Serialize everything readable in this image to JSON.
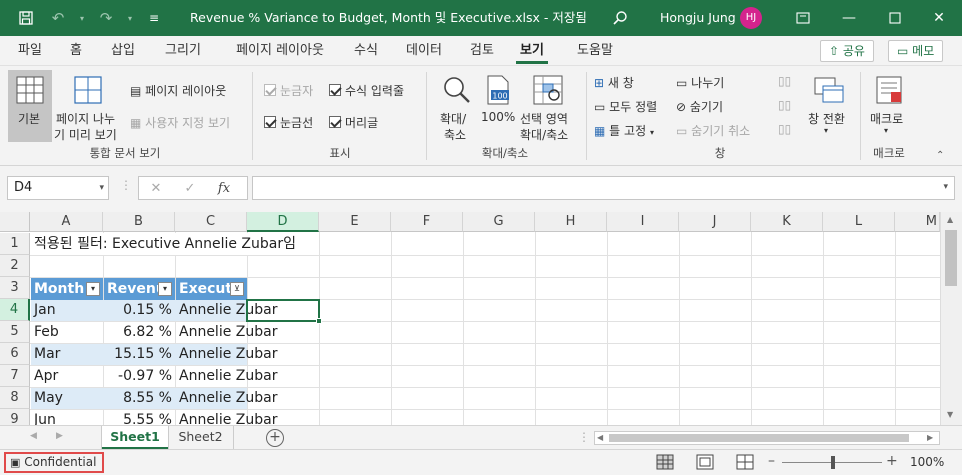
{
  "titlebar": {
    "title": "Revenue % Variance to Budget, Month 및 Executive.xlsx  -  저장됨",
    "user": "Hongju Jung",
    "avatar_initials": "HJ",
    "accent": "#217346"
  },
  "tabs": [
    "파일",
    "홈",
    "삽입",
    "그리기",
    "페이지 레이아웃",
    "수식",
    "데이터",
    "검토",
    "보기",
    "도움말"
  ],
  "active_tab": "보기",
  "share_label": "공유",
  "memo_label": "메모",
  "ribbon": {
    "workbook_views": {
      "normal": "기본",
      "page_break_1": "페이지 나누",
      "page_break_2": "기 미리 보기",
      "page_layout": "페이지 레이아웃",
      "custom_views": "사용자 지정 보기",
      "group_label": "통합 문서 보기"
    },
    "show": {
      "ruler": "눈금자",
      "formula_bar": "수식 입력줄",
      "gridlines": "눈금선",
      "headings": "머리글",
      "group_label": "표시"
    },
    "zoom": {
      "zoom_1": "확대/",
      "zoom_2": "축소",
      "hundred": "100%",
      "hundred_icon": "100",
      "zoom_sel_1": "선택 영역",
      "zoom_sel_2": "확대/축소",
      "group_label": "확대/축소"
    },
    "window": {
      "new_window": "새 창",
      "arrange_all": "모두 정렬",
      "freeze": "틀 고정",
      "split": "나누기",
      "hide": "숨기기",
      "unhide": "숨기기 취소",
      "switch_windows": "창 전환",
      "group_label": "창"
    },
    "macros": {
      "label": "매크로",
      "group_label": "매크로"
    }
  },
  "formula_bar": {
    "name_box": "D4",
    "fx": "fx",
    "formula": ""
  },
  "grid": {
    "columns": [
      "A",
      "B",
      "C",
      "D",
      "E",
      "F",
      "G",
      "H",
      "I",
      "J",
      "K",
      "L",
      "M"
    ],
    "rows": [
      "1",
      "2",
      "3",
      "4",
      "5",
      "6",
      "7",
      "8",
      "9"
    ],
    "filter_note": "적용된 필터: Executive Annelie Zubar임",
    "headers": [
      "Month",
      "Revenu",
      "Executi"
    ],
    "data": [
      {
        "month": "Jan",
        "revenue": "0.15 %",
        "exec": "Annelie Zubar"
      },
      {
        "month": "Feb",
        "revenue": "6.82 %",
        "exec": "Annelie Zubar"
      },
      {
        "month": "Mar",
        "revenue": "15.15 %",
        "exec": "Annelie Zubar"
      },
      {
        "month": "Apr",
        "revenue": "-0.97 %",
        "exec": "Annelie Zubar"
      },
      {
        "month": "May",
        "revenue": "8.55 %",
        "exec": "Annelie Zubar"
      },
      {
        "month": "Jun",
        "revenue": "5.55 %",
        "exec": "Annelie Zubar"
      }
    ]
  },
  "sheets": [
    "Sheet1",
    "Sheet2"
  ],
  "active_sheet": "Sheet1",
  "status": {
    "sensitivity": "Confidential",
    "zoom": "100%"
  }
}
